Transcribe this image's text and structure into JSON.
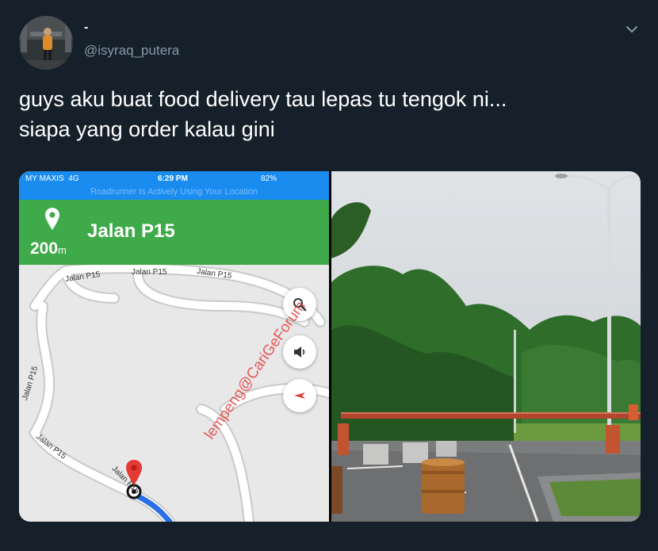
{
  "tweet": {
    "display_name": "-",
    "handle": "@isyraq_putera",
    "text_line1": "guys aku buat food delivery tau lepas tu tengok ni...",
    "text_line2": "siapa yang order kalau gini"
  },
  "screenshot": {
    "carrier": "MY MAXIS",
    "network": "4G",
    "time": "6:29 PM",
    "battery": "82%",
    "notice": "Roadrunner Is Actively Using Your Location",
    "street": "Jalan P15",
    "distance_value": "200",
    "distance_unit": "m",
    "road_labels": [
      "Jalan P15",
      "Jalan P15",
      "Jalan P15",
      "Jalan P15",
      "Jalan P15",
      "Jalan P15"
    ]
  },
  "watermark": "lempeng@CariGeForum",
  "icons": {
    "caret": "chevron-down-icon",
    "search": "search-icon",
    "volume": "speaker-icon",
    "compass": "compass-icon",
    "pin": "location-pin-icon"
  }
}
